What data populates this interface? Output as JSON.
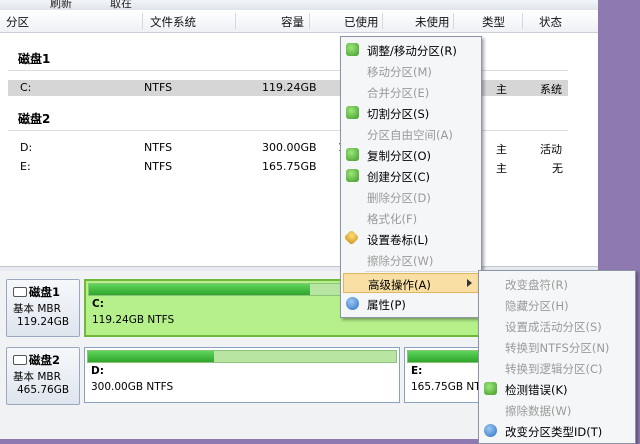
{
  "toolbar": {
    "item1": "刷新",
    "item2": "取在"
  },
  "columns": {
    "partition": "分区",
    "filesystem": "文件系统",
    "capacity": "容量",
    "used": "已使用",
    "unused": "未使用",
    "type": "类型",
    "status": "状态"
  },
  "disks": [
    {
      "title": "磁盘1",
      "rows": [
        {
          "name": "C:",
          "fs": "NTFS",
          "capacity": "119.24GB",
          "type": "主",
          "status": "系统"
        }
      ]
    },
    {
      "title": "磁盘2",
      "rows": [
        {
          "name": "D:",
          "fs": "NTFS",
          "capacity": "300.00GB",
          "used_partial": "1",
          "type": "主",
          "status": "活动"
        },
        {
          "name": "E:",
          "fs": "NTFS",
          "capacity": "165.75GB",
          "type": "主",
          "status": "无"
        }
      ]
    }
  ],
  "map": {
    "disk1": {
      "title": "磁盘1",
      "kind": "基本 MBR",
      "size": "119.24GB",
      "partitions": [
        {
          "label": "C:",
          "desc": "119.24GB NTFS",
          "fill_percent": 44
        }
      ]
    },
    "disk2": {
      "title": "磁盘2",
      "kind": "基本 MBR",
      "size": "465.76GB",
      "partitions": [
        {
          "label": "D:",
          "desc": "300.00GB NTFS",
          "fill_percent": 41
        },
        {
          "label": "E:",
          "desc": "165.75GB NTFS",
          "fill_percent": 60
        }
      ]
    }
  },
  "context_menu": [
    {
      "label": "调整/移动分区(R)",
      "enabled": true,
      "icon": "resize-icon"
    },
    {
      "label": "移动分区(M)",
      "enabled": false
    },
    {
      "label": "合并分区(E)",
      "enabled": false
    },
    {
      "label": "切割分区(S)",
      "enabled": true,
      "icon": "split-icon"
    },
    {
      "label": "分区自由空间(A)",
      "enabled": false
    },
    {
      "label": "复制分区(O)",
      "enabled": true,
      "icon": "copy-icon"
    },
    {
      "label": "创建分区(C)",
      "enabled": true,
      "icon": "create-icon"
    },
    {
      "label": "删除分区(D)",
      "enabled": false
    },
    {
      "label": "格式化(F)",
      "enabled": false
    },
    {
      "label": "设置卷标(L)",
      "enabled": true,
      "icon": "label-icon"
    },
    {
      "label": "擦除分区(W)",
      "enabled": false
    },
    {
      "label": "高级操作(A)",
      "enabled": true,
      "highlighted": true,
      "submenu": true
    },
    {
      "label": "属性(P)",
      "enabled": true,
      "icon": "info-icon"
    }
  ],
  "submenu": [
    {
      "label": "改变盘符(R)",
      "enabled": false
    },
    {
      "label": "隐藏分区(H)",
      "enabled": false
    },
    {
      "label": "设置成活动分区(S)",
      "enabled": false
    },
    {
      "label": "转换到NTFS分区(N)",
      "enabled": false
    },
    {
      "label": "转换到逻辑分区(C)",
      "enabled": false
    },
    {
      "label": "检测错误(K)",
      "enabled": true,
      "icon": "check-icon"
    },
    {
      "label": "擦除数据(W)",
      "enabled": false
    },
    {
      "label": "改变分区类型ID(T)",
      "enabled": true,
      "icon": "type-id-icon"
    }
  ]
}
